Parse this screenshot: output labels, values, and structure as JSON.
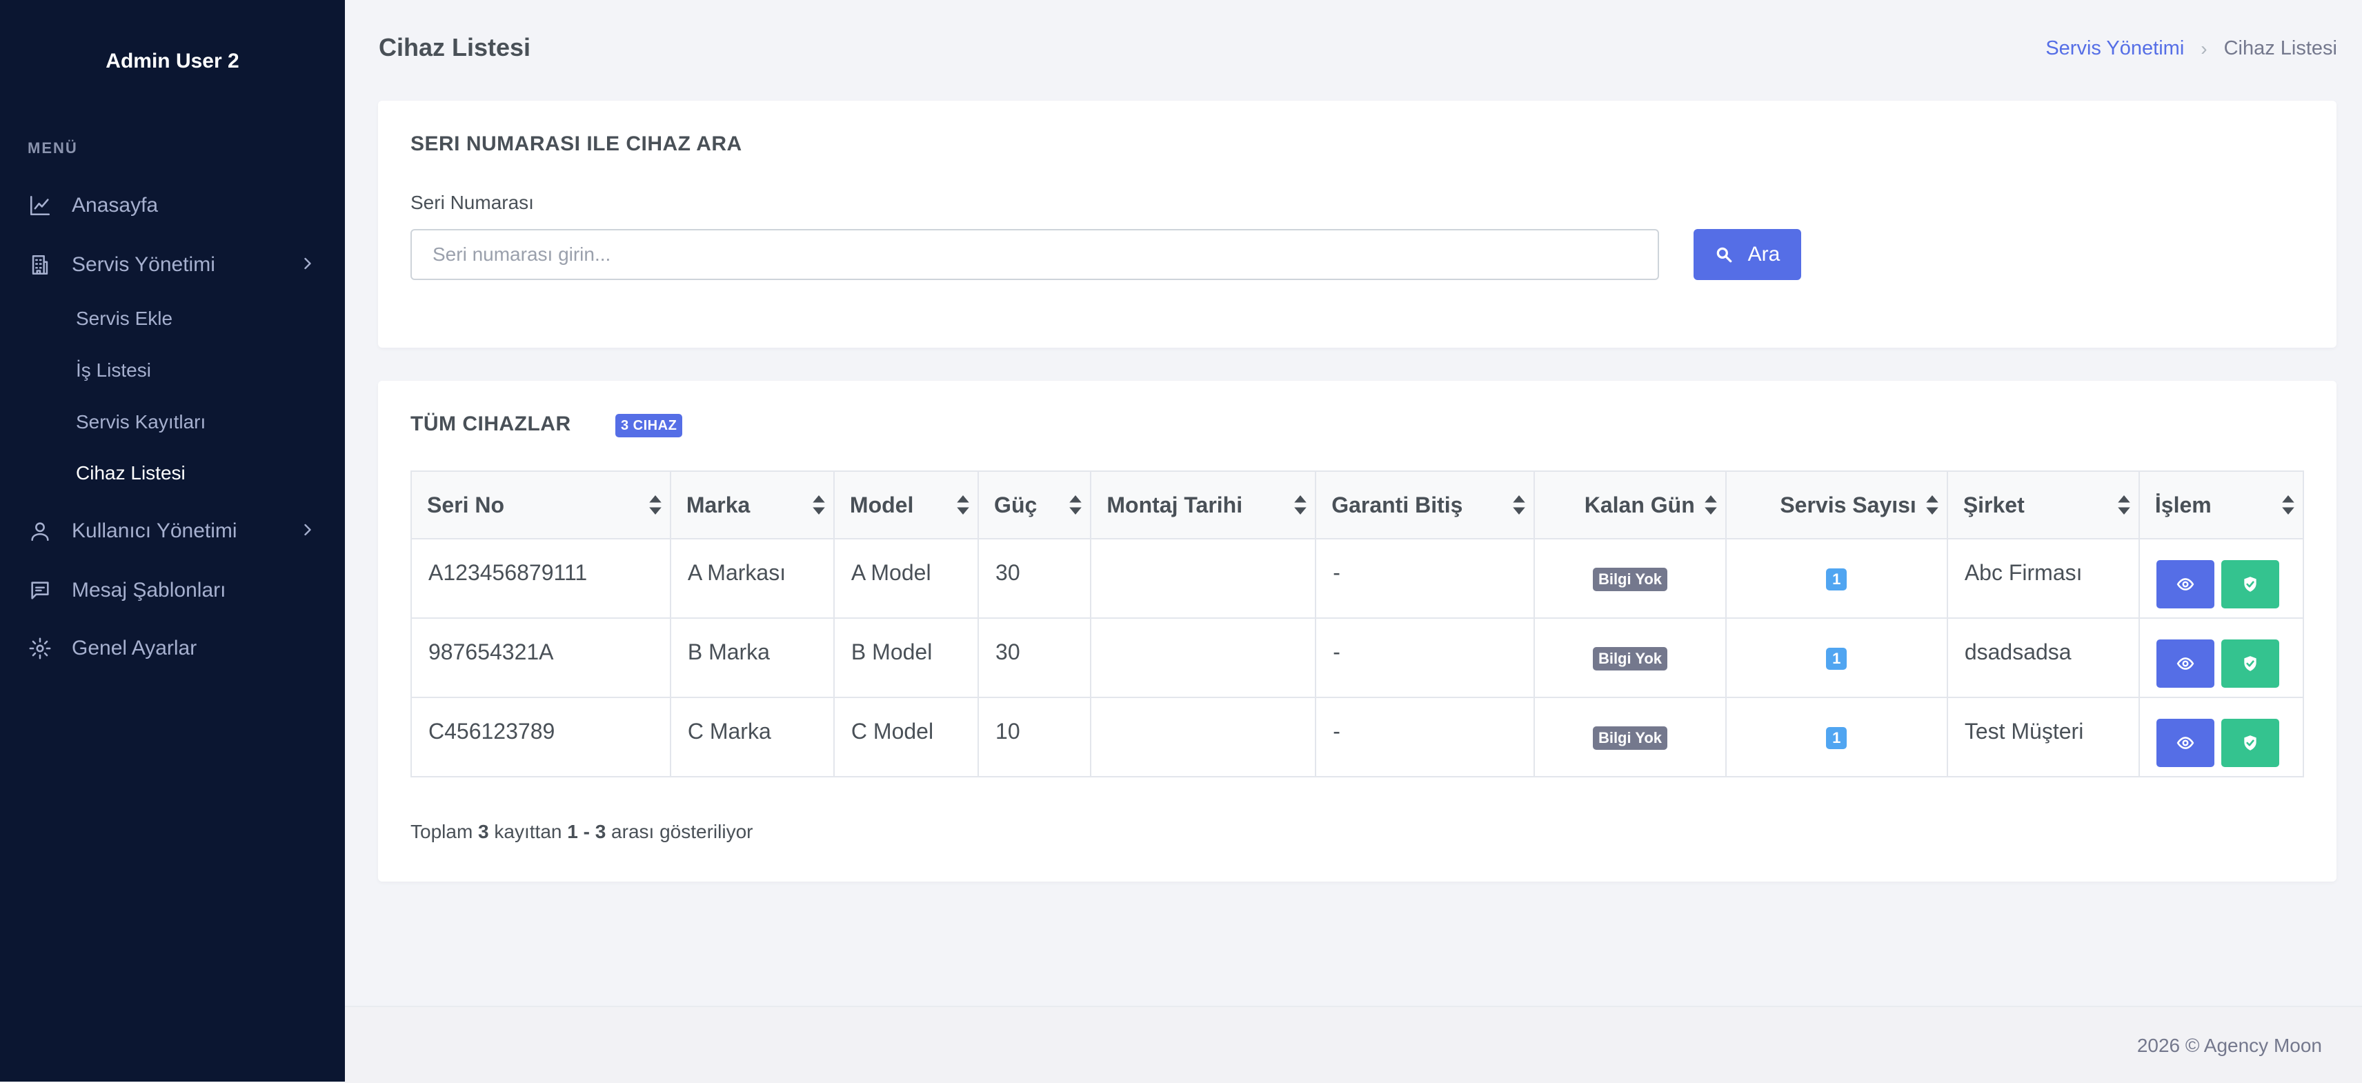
{
  "sidebar": {
    "user_name": "Admin User 2",
    "menu_title": "MENÜ",
    "items": [
      {
        "label": "Anasayfa",
        "icon": "chart-line-icon"
      },
      {
        "label": "Servis Yönetimi",
        "icon": "building-icon",
        "expandable": true
      },
      {
        "label": "Kullanıcı Yönetimi",
        "icon": "user-icon",
        "expandable": true
      },
      {
        "label": "Mesaj Şablonları",
        "icon": "message-icon"
      },
      {
        "label": "Genel Ayarlar",
        "icon": "gear-icon"
      }
    ],
    "sub_items": [
      {
        "label": "Servis Ekle",
        "active": false
      },
      {
        "label": "İş Listesi",
        "active": false
      },
      {
        "label": "Servis Kayıtları",
        "active": false
      },
      {
        "label": "Cihaz Listesi",
        "active": true
      }
    ]
  },
  "header": {
    "title": "Cihaz Listesi",
    "breadcrumb": [
      "Servis Yönetimi",
      "Cihaz Listesi"
    ]
  },
  "search_card": {
    "title": "SERI NUMARASI ILE CIHAZ ARA",
    "field_label": "Seri Numarası",
    "placeholder": "Seri numarası girin...",
    "value": "",
    "button_label": "Ara"
  },
  "devices_card": {
    "title": "TÜM CIHAZLAR",
    "count_badge": "3 CIHAZ",
    "columns": [
      "Seri No",
      "Marka",
      "Model",
      "Güç",
      "Montaj Tarihi",
      "Garanti Bitiş",
      "Kalan Gün",
      "Servis Sayısı",
      "Şirket",
      "İşlem"
    ],
    "rows": [
      {
        "serial": "A123456879111",
        "brand": "A Markası",
        "model": "A Model",
        "power": "30",
        "install_date": "",
        "warranty_end": "-",
        "days_left": "Bilgi Yok",
        "service_count": "1",
        "company": "Abc Firması"
      },
      {
        "serial": "987654321A",
        "brand": "B Marka",
        "model": "B Model",
        "power": "30",
        "install_date": "",
        "warranty_end": "-",
        "days_left": "Bilgi Yok",
        "service_count": "1",
        "company": "dsadsadsa"
      },
      {
        "serial": "C456123789",
        "brand": "C Marka",
        "model": "C Model",
        "power": "10",
        "install_date": "",
        "warranty_end": "-",
        "days_left": "Bilgi Yok",
        "service_count": "1",
        "company": "Test Müşteri"
      }
    ],
    "summary": {
      "prefix": "Toplam ",
      "total": "3",
      "middle": " kayıttan ",
      "range": "1 - 3",
      "suffix": " arası gösteriliyor"
    }
  },
  "footer": {
    "text": "2026 © Agency Moon"
  },
  "colors": {
    "sidebar_bg": "#0b1631",
    "primary": "#556ee6",
    "success": "#34c38f",
    "info": "#50a5f1",
    "secondary": "#74788d"
  }
}
